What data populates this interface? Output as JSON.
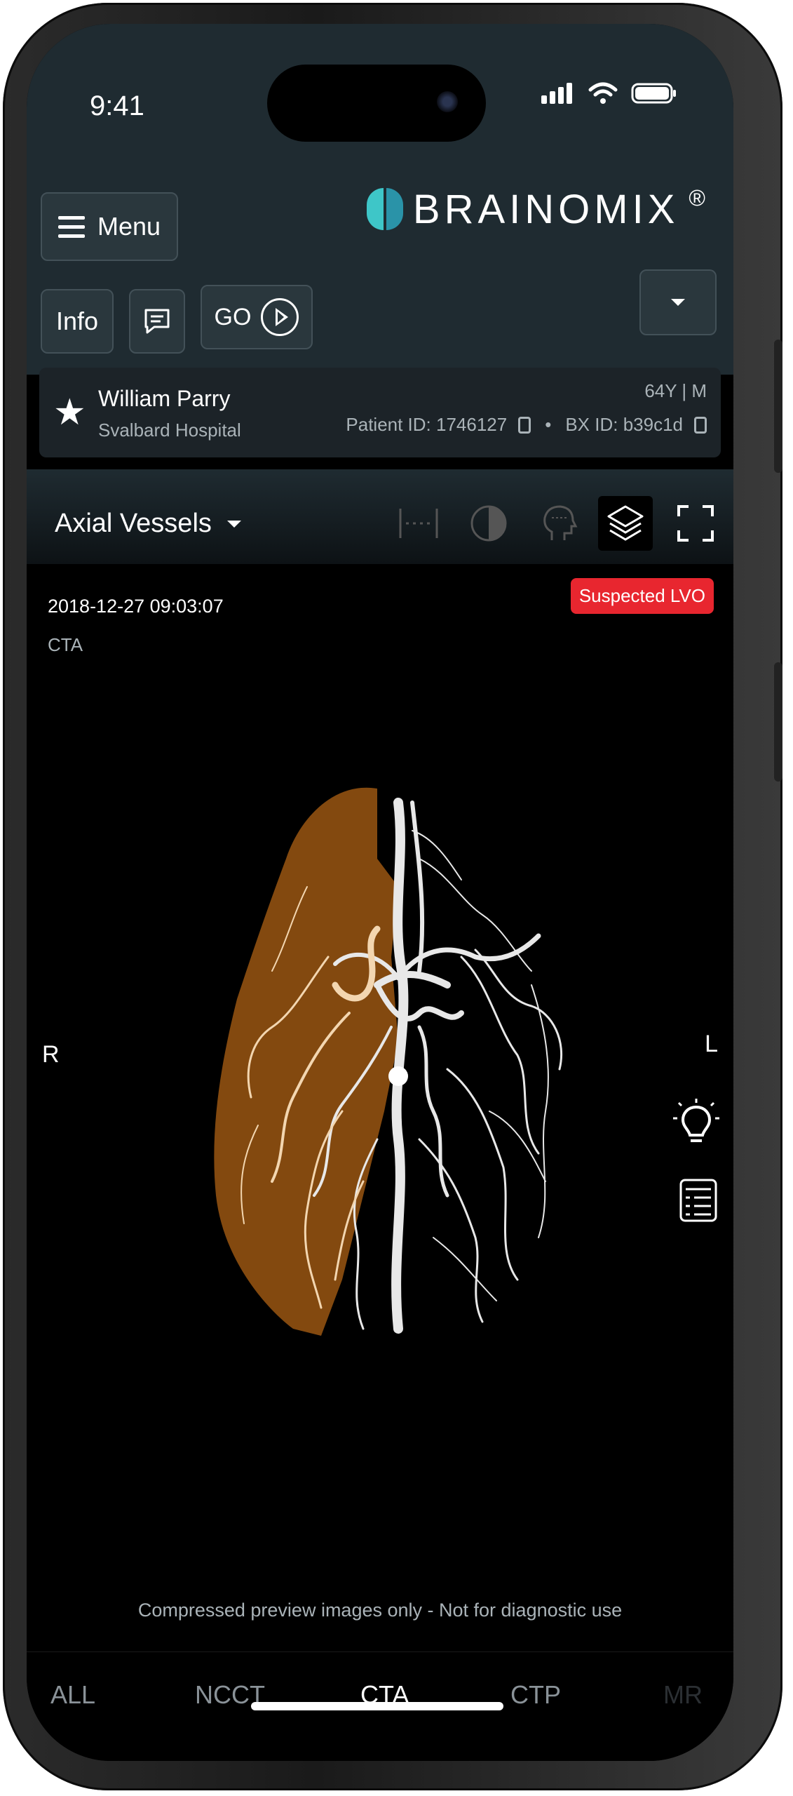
{
  "status_bar": {
    "time": "9:41"
  },
  "header": {
    "menu_label": "Menu",
    "brand": "BRAINOMIX",
    "brand_mark": "®",
    "info_label": "Info",
    "go_label": "GO"
  },
  "patient": {
    "name": "William Parry",
    "hospital": "Svalbard Hospital",
    "age_sex": "64Y | M",
    "patient_id": "Patient ID: 1746127",
    "separator": "•",
    "bx_id": "BX ID: b39c1d"
  },
  "toolbar": {
    "view_label": "Axial Vessels"
  },
  "viewer": {
    "datetime": "2018-12-27 09:03:07",
    "modality": "CTA",
    "alert": "Suspected LVO",
    "right_marker": "R",
    "left_marker": "L",
    "disclaimer": "Compressed preview images only - Not for diagnostic use"
  },
  "tabs": [
    {
      "label": "ALL",
      "color": "#8a9298"
    },
    {
      "label": "NCCT",
      "color": "#8a9298"
    },
    {
      "label": "CTA",
      "color": "#ffffff"
    },
    {
      "label": "CTP",
      "color": "#8a9298"
    },
    {
      "label": "MR",
      "color": "#2b2f33"
    }
  ],
  "colors": {
    "accent": "#3ec6c8",
    "alert": "#e8262f",
    "highlight": "#8a4d10"
  }
}
